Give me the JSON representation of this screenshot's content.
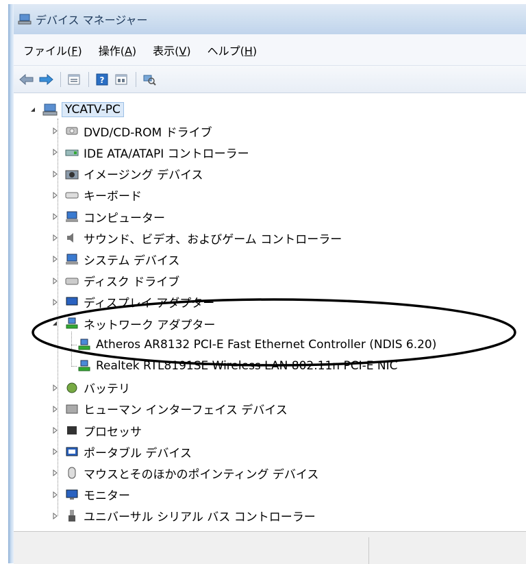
{
  "window": {
    "title": "デバイス マネージャー"
  },
  "menu": [
    {
      "label": "ファイル(",
      "key": "F",
      "tail": ")"
    },
    {
      "label": "操作(",
      "key": "A",
      "tail": ")"
    },
    {
      "label": "表示(",
      "key": "V",
      "tail": ")"
    },
    {
      "label": "ヘルプ(",
      "key": "H",
      "tail": ")"
    }
  ],
  "toolbar": [
    "back-arrow-icon",
    "forward-arrow-icon",
    "properties-icon",
    "help-icon",
    "view-icon",
    "scan-hardware-icon"
  ],
  "tree": {
    "root": "YCATV-PC",
    "items": [
      "DVD/CD-ROM ドライブ",
      "IDE ATA/ATAPI コントローラー",
      "イメージング デバイス",
      "キーボード",
      "コンピューター",
      "サウンド、ビデオ、およびゲーム コントローラー",
      "システム デバイス",
      "ディスク ドライブ",
      "ディスプレイ アダプター",
      "ネットワーク アダプター",
      "バッテリ",
      "ヒューマン インターフェイス デバイス",
      "プロセッサ",
      "ポータブル デバイス",
      "マウスとそのほかのポインティング デバイス",
      "モニター",
      "ユニバーサル シリアル バス コントローラー"
    ],
    "network_children": [
      "Atheros AR8132 PCI-E Fast Ethernet Controller (NDIS 6.20)",
      "Realtek RTL8191SE Wireless LAN 802.11n PCI-E NIC"
    ]
  },
  "colors": {
    "accent": "#1e395b",
    "selection": "#dbe9f8",
    "annotation": "#000000"
  }
}
